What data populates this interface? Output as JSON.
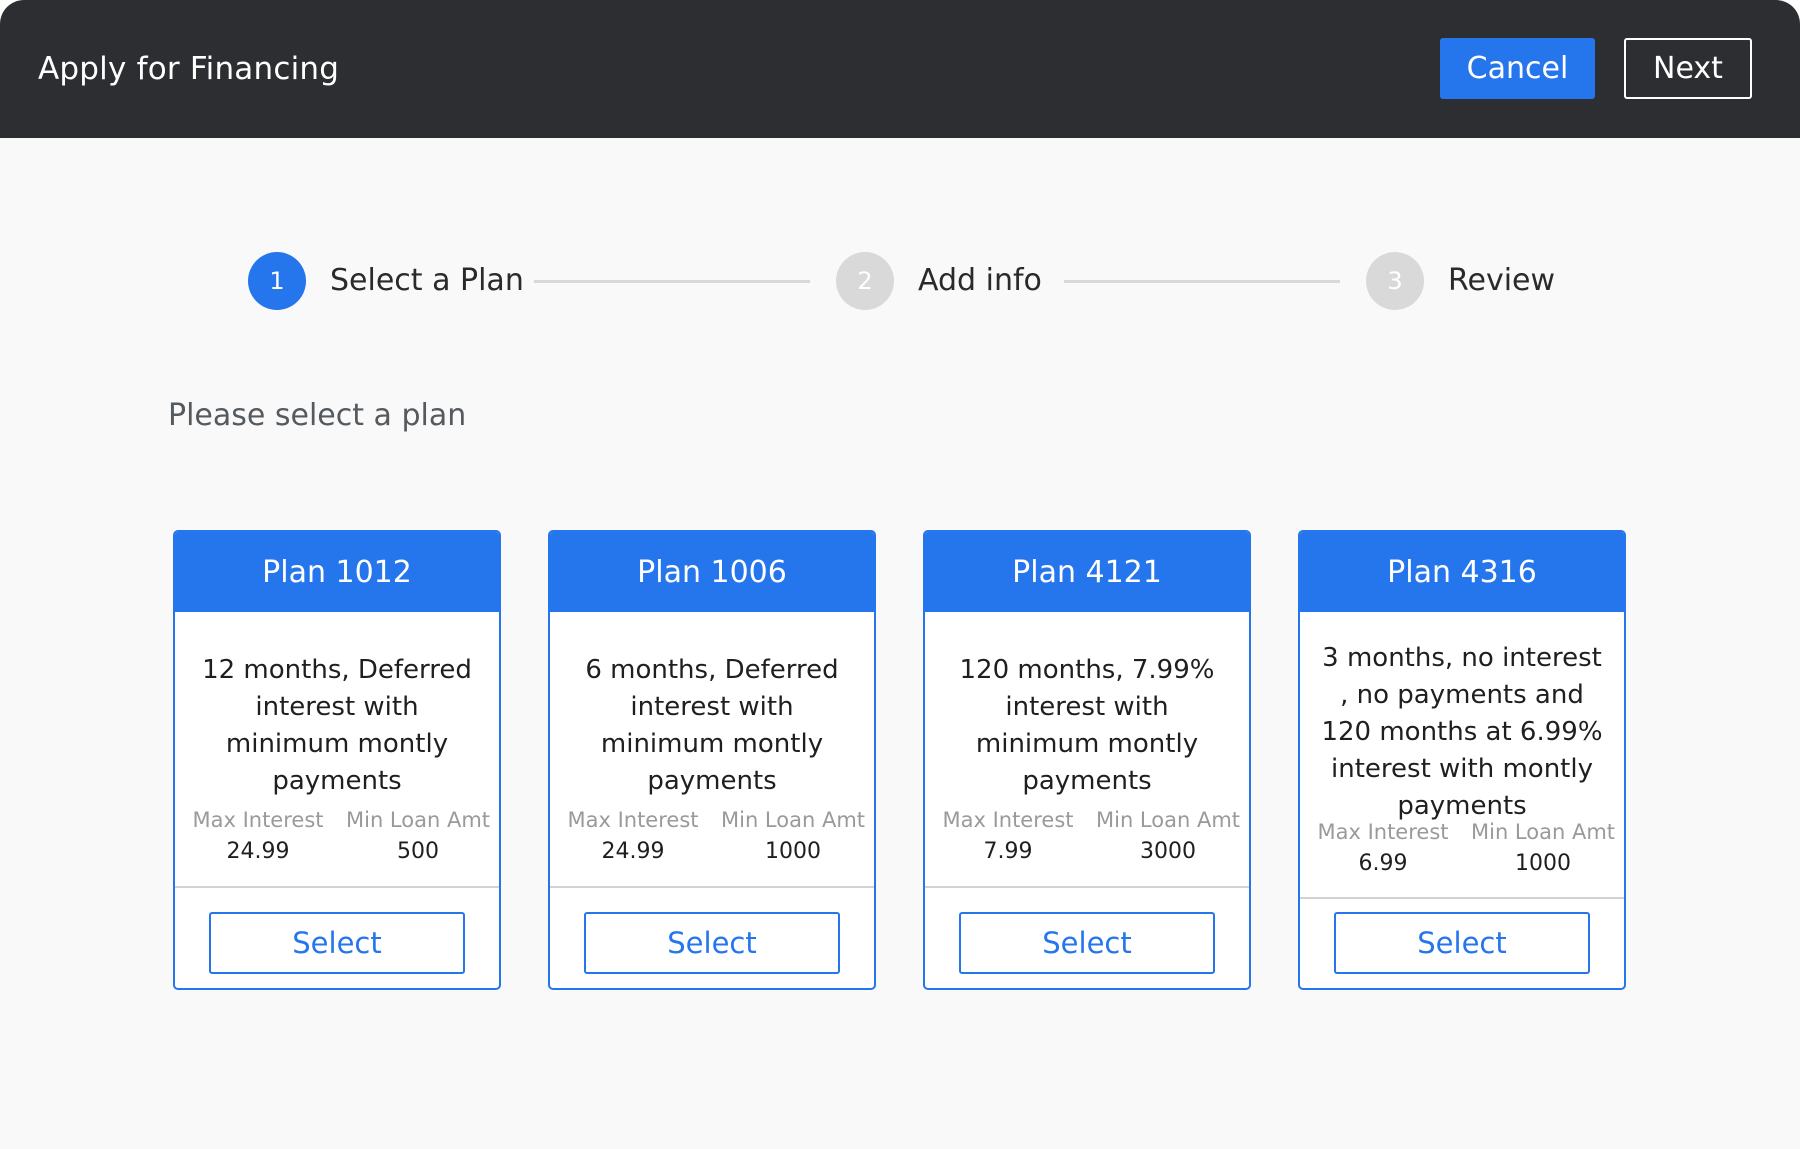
{
  "header": {
    "title": "Apply for Financing",
    "cancel_label": "Cancel",
    "next_label": "Next"
  },
  "stepper": {
    "steps": [
      {
        "number": "1",
        "label": "Select a Plan",
        "state": "active"
      },
      {
        "number": "2",
        "label": "Add info",
        "state": "inactive"
      },
      {
        "number": "3",
        "label": "Review",
        "state": "inactive"
      }
    ]
  },
  "main": {
    "prompt": "Please select a plan",
    "stat_labels": {
      "max_interest": "Max Interest",
      "min_loan": "Min Loan Amt"
    },
    "select_label": "Select",
    "plans": [
      {
        "name": "Plan 1012",
        "description": "12 months, Deferred interest with minimum montly payments",
        "max_interest": "24.99",
        "min_loan": "500"
      },
      {
        "name": "Plan 1006",
        "description": "6 months, Deferred interest with minimum montly payments",
        "max_interest": "24.99",
        "min_loan": "1000"
      },
      {
        "name": "Plan 4121",
        "description": "120 months, 7.99% interest with minimum montly payments",
        "max_interest": "7.99",
        "min_loan": "3000"
      },
      {
        "name": "Plan 4316",
        "description": "3 months, no interest , no payments and 120 months at 6.99% interest with montly payments",
        "max_interest": "6.99",
        "min_loan": "1000"
      }
    ]
  },
  "colors": {
    "header_bg": "#2d2e31",
    "accent": "#2575ec",
    "page_bg": "#f9f9f9",
    "step_inactive": "#d9d9d9"
  }
}
